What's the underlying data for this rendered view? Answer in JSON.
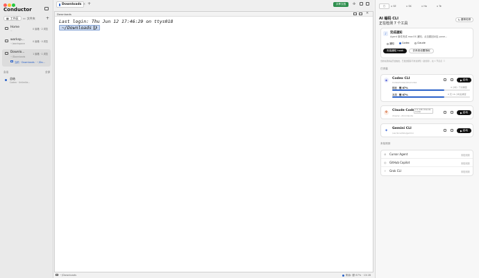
{
  "app": {
    "title": "Conductor"
  },
  "sidebar": {
    "tab_workspace": "工作区",
    "tab_files": "文件夹",
    "workspaces": [
      {
        "name": "Home",
        "sub": "~",
        "badges": "0 窗格 · 2 浏览"
      },
      {
        "name": "worksp...",
        "sub": "~/workspace",
        "badges": "0 窗格 · 0 浏览"
      },
      {
        "name": "Downlo...",
        "sub": "~/Downloads",
        "badges": "1 窗格 · 1 浏览",
        "session": "当前 · Downloads · ~/Do..."
      }
    ],
    "section_label": "会话",
    "section_action": "全部",
    "session": {
      "name": "总结",
      "sub": "Codex · Unlimite..."
    }
  },
  "main": {
    "tab_label": "Downloads",
    "tab_plus": "+",
    "header_btn": "共享文档",
    "pane_title": "Downloads",
    "terminal_lines": [
      "Last login: Thu Jun 12 17:46:29 on ttys018"
    ],
    "prompt": "~/Downloads",
    "status_left": "~/Downloads",
    "status_right": "剩余: 额 67% · 13:28"
  },
  "right_tabs": [
    "",
    "SE",
    "SK",
    "Ho",
    "Te"
  ],
  "right": {
    "title": "AI 编码 CLI",
    "subtitle": "正在检测 7 个工具",
    "refresh_btn": "重新检测",
    "notify": {
      "title": "完成通知",
      "desc": "Agent 事件完成 macOS 通知，点击跳回对应 pane...",
      "options": [
        "通知",
        "Codex",
        "Claude"
      ],
      "btn_install": "安装通知 hook",
      "btn_settings": "去系统设置授权",
      "note": "当前先观察是否会触发，已发送跟踪不重复通知（最终用），在 1 节点点（）"
    },
    "installed_label": "已安装",
    "tools": [
      {
        "name": "Codex CLI",
        "sub": "Codex/Codex/bin/codex",
        "start": "启动",
        "meters": [
          {
            "label": "额度",
            "value": "剩 67%",
            "fill": 0.67,
            "note": "4 小时 / 下次重置"
          },
          {
            "label": "本周",
            "value": "剩 67%",
            "fill": 0.67,
            "note": "6 天 16 小时后重置"
          }
        ]
      },
      {
        "name": "Claude Code",
        "version": "2.1.146 (Claude Code)",
        "sub": "/Users/.../bin/claude",
        "start": "启动"
      },
      {
        "name": "Gemini CLI",
        "sub": "/usr/local/bin/gemini",
        "start": "启动"
      }
    ],
    "not_installed_label": "未检测到",
    "missing": [
      {
        "name": "Cursor Agent",
        "status": "未检测到"
      },
      {
        "name": "GitHub Copilot",
        "status": "未检测到"
      },
      {
        "name": "Grok CLI",
        "status": "未检测到"
      }
    ]
  },
  "colors": {
    "accent": "#2a62c9",
    "start_btn": "#111111",
    "share_btn": "#2f8f4e"
  }
}
